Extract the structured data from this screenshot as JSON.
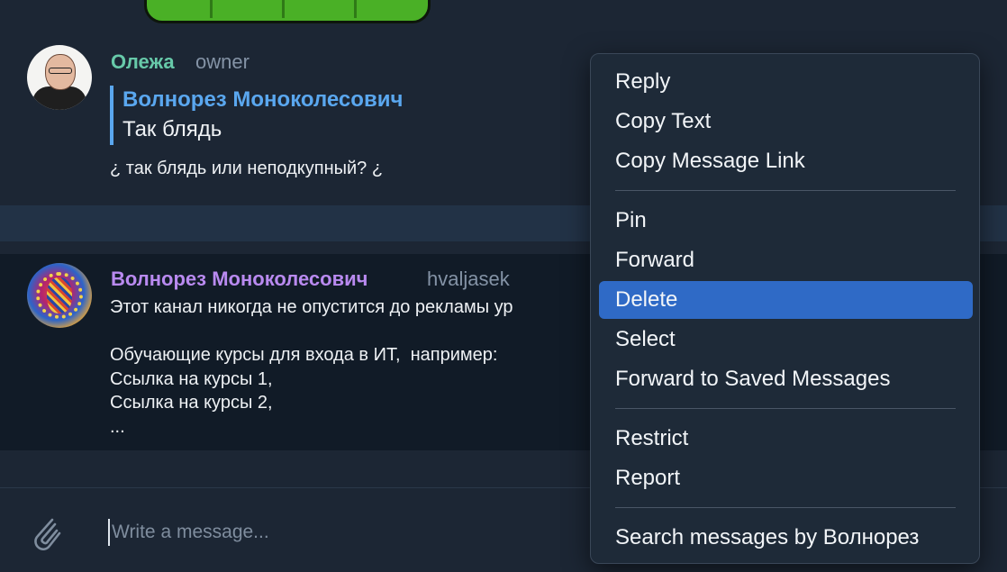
{
  "messages": [
    {
      "author": "Олежа",
      "badge": "owner",
      "author_color": "#67c9a9",
      "reply_to": {
        "author": "Волнорез Моноколесович",
        "text": "Так блядь"
      },
      "text": "¿ так блядь или неподкупный? ¿"
    },
    {
      "author": "Волнорез Моноколесович",
      "badge": "hvaljasek",
      "author_color": "#b98af0",
      "text": "Этот канал никогда не опустится до рекламы ур\n\nОбучающие курсы для входа в ИТ,  например:\nСсылка на курсы 1,\nСсылка на курсы 2,\n..."
    }
  ],
  "composer": {
    "placeholder": "Write a message...",
    "attach_icon": "paperclip-icon"
  },
  "context_menu": {
    "items": [
      "Reply",
      "Copy Text",
      "Copy Message Link",
      "Pin",
      "Forward",
      "Delete",
      "Select",
      "Forward to Saved Messages",
      "Restrict",
      "Report",
      "Search messages by Волнорез"
    ],
    "highlighted": "Delete",
    "highlight_color": "#2f6ac6"
  },
  "colors": {
    "background": "#1c2634",
    "accent": "#5aa7ef"
  }
}
